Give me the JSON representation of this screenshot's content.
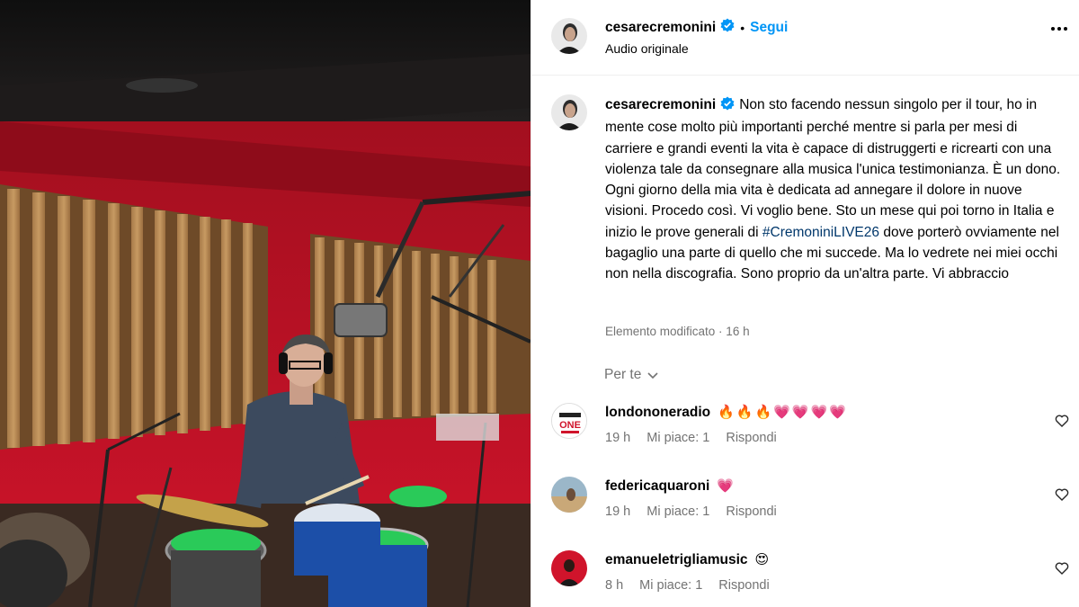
{
  "post": {
    "username": "cesarecremonini",
    "follow_label": "Segui",
    "separator": "•",
    "audio_label": "Audio originale"
  },
  "caption": {
    "username": "cesarecremonini",
    "text_1": "Non sto facendo nessun singolo per il tour, ho in mente cose molto più importanti perché mentre si parla per mesi di carriere e grandi eventi la vita è capace di distruggerti e ricrearti con una violenza tale da consegnare alla musica l'unica testimonianza. È un dono. Ogni giorno della mia vita è dedicata ad annegare il dolore in nuove visioni. Procedo così. Vi voglio bene. Sto un mese qui poi torno in Italia e inizio le prove generali di ",
    "hashtag": "#CremoniniLIVE26",
    "text_2": " dove porterò ovviamente nel bagaglio una parte di quello che mi succede. Ma lo vedrete nei miei occhi non nella discografia. Sono proprio da un'altra parte. Vi abbraccio",
    "edited": "Elemento modificato · 16 h"
  },
  "filter": {
    "label": "Per te"
  },
  "comments": [
    {
      "username": "londononeradio",
      "text": "🔥🔥🔥💗💗💗💗",
      "time": "19 h",
      "likes": "Mi piace: 1",
      "reply": "Rispondi"
    },
    {
      "username": "federicaquaroni",
      "text": "💗",
      "time": "19 h",
      "likes": "Mi piace: 1",
      "reply": "Rispondi"
    },
    {
      "username": "emanueletrigliamusic",
      "text": "😍",
      "time": "8 h",
      "likes": "Mi piace: 1",
      "reply": "Rispondi"
    }
  ],
  "colors": {
    "link_blue": "#0095f6",
    "hashtag_blue": "#00376b",
    "muted": "#737373",
    "verified": "#0095f6",
    "studio_red": "#c8102e"
  },
  "icons": {
    "verified": "verified-badge-icon",
    "more": "more-options-icon",
    "chevron": "chevron-down-icon",
    "heart": "heart-outline-icon"
  }
}
